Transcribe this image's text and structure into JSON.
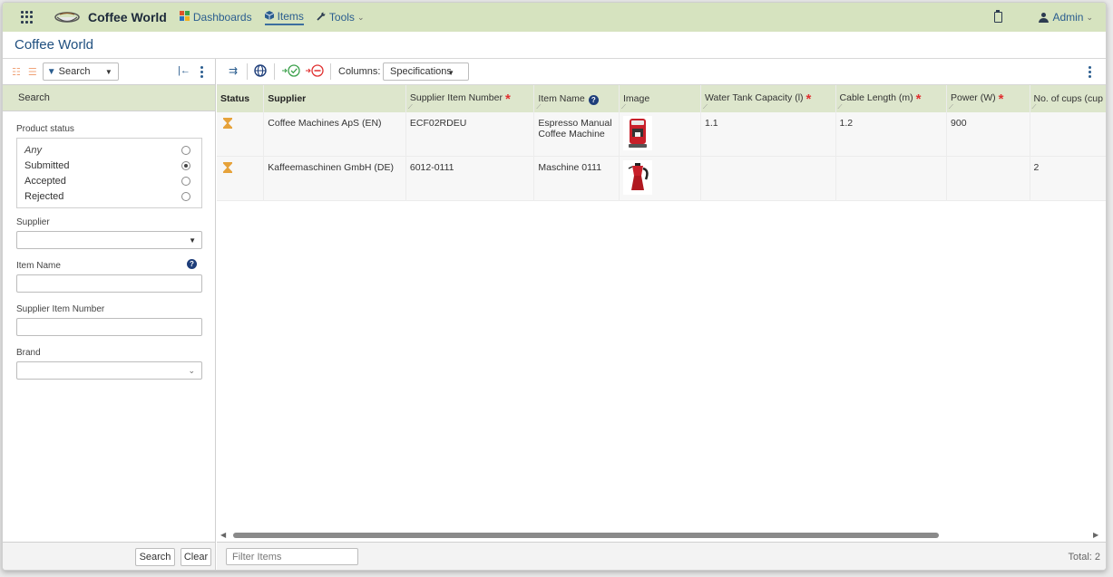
{
  "nav": {
    "brand": "Coffee World",
    "items": [
      {
        "label": "Dashboards",
        "icon": "dashboard-icon"
      },
      {
        "label": "Items",
        "icon": "box-icon"
      },
      {
        "label": "Tools",
        "icon": "wrench-icon"
      }
    ],
    "tools_chevron": "⌄",
    "user": "Admin",
    "user_chevron": "⌄"
  },
  "page": {
    "title": "Coffee World"
  },
  "left": {
    "search_button": "Search",
    "panel_title": "Search",
    "product_status": {
      "label": "Product status",
      "options": [
        "Any",
        "Submitted",
        "Accepted",
        "Rejected"
      ],
      "selected": "Submitted"
    },
    "supplier_label": "Supplier",
    "supplier_value": "",
    "item_name_label": "Item Name",
    "item_name_value": "",
    "supplier_item_number_label": "Supplier Item Number",
    "supplier_item_number_value": "",
    "brand_label": "Brand",
    "brand_value": "",
    "search_action": "Search",
    "clear_action": "Clear"
  },
  "toolbar": {
    "columns_label": "Columns:",
    "columns_value": "Specifications"
  },
  "grid": {
    "columns": [
      {
        "label": "Status",
        "bold": true,
        "required": false
      },
      {
        "label": "Supplier",
        "bold": true,
        "required": false
      },
      {
        "label": "Supplier Item Number",
        "bold": false,
        "required": true
      },
      {
        "label": "Item Name",
        "bold": false,
        "required": false,
        "help": true
      },
      {
        "label": "Image",
        "bold": false,
        "required": false
      },
      {
        "label": "Water Tank Capacity (l)",
        "bold": false,
        "required": true
      },
      {
        "label": "Cable Length (m)",
        "bold": false,
        "required": true
      },
      {
        "label": "Power (W)",
        "bold": false,
        "required": true
      },
      {
        "label": "No. of cups (cup",
        "bold": false,
        "required": false
      }
    ],
    "rows": [
      {
        "status_icon": "hourglass-icon",
        "supplier": "Coffee Machines ApS (EN)",
        "supplier_item_number": "ECF02RDEU",
        "item_name": "Espresso Manual Coffee Machine",
        "image": "espresso-machine-image",
        "water_tank": "1.1",
        "cable_length": "1.2",
        "power": "900",
        "cups": ""
      },
      {
        "status_icon": "hourglass-icon",
        "supplier": "Kaffeemaschinen GmbH (DE)",
        "supplier_item_number": "6012-0111",
        "item_name": "Maschine 0111",
        "image": "moka-pot-image",
        "water_tank": "",
        "cable_length": "",
        "power": "",
        "cups": "2"
      }
    ]
  },
  "footer": {
    "filter_placeholder": "Filter Items",
    "total": "Total: 2"
  },
  "colors": {
    "header_bg": "#d6e3bf",
    "grid_header_bg": "#dde6cc",
    "accent": "#2a5d8f",
    "required": "#e03030",
    "pending": "#e6a23a"
  }
}
